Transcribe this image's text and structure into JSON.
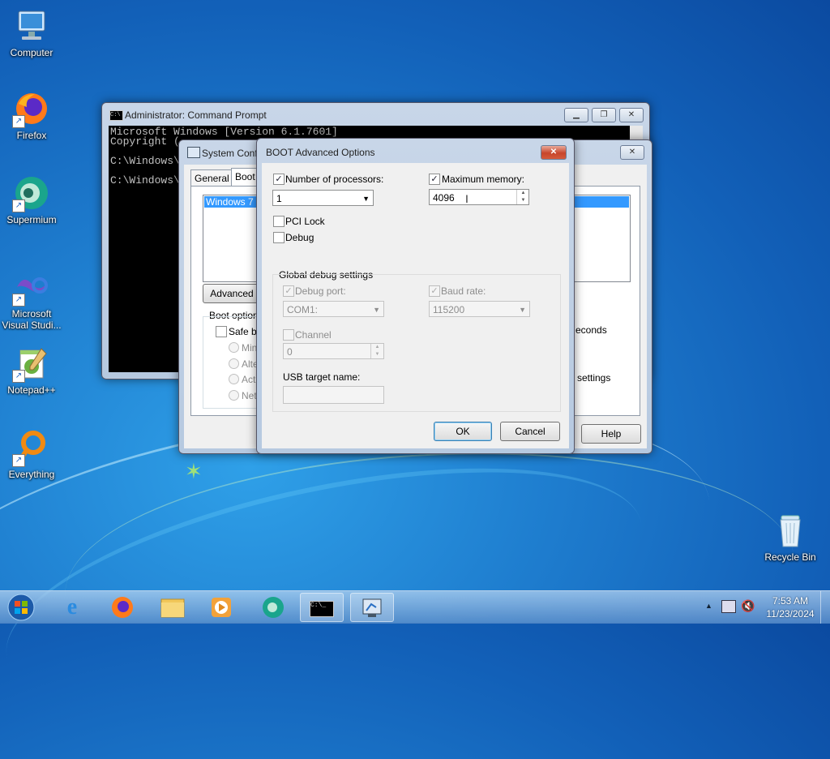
{
  "desktop": {
    "icons": [
      {
        "label": "Computer",
        "icon": "computer-icon"
      },
      {
        "label": "Firefox",
        "icon": "firefox-icon"
      },
      {
        "label": "Supermium",
        "icon": "supermium-icon"
      },
      {
        "label": "Microsoft Visual Studi...",
        "icon": "visual-studio-icon"
      },
      {
        "label": "Notepad++",
        "icon": "notepadpp-icon"
      },
      {
        "label": "Everything",
        "icon": "everything-icon"
      },
      {
        "label": "Recycle Bin",
        "icon": "recycle-bin-icon"
      }
    ]
  },
  "cmd": {
    "title": "Administrator: Command Prompt",
    "lines": [
      "Microsoft Windows [Version 6.1.7601]",
      "Copyright (",
      "",
      "C:\\Windows\\",
      "",
      "C:\\Windows\\"
    ]
  },
  "sysconfig": {
    "title": "System Conf",
    "tabs": [
      "General",
      "Boot"
    ],
    "os_entry": "Windows 7 (C",
    "advanced_button": "Advanced o",
    "boot_options_label": "Boot options",
    "safe_boot": "Safe bo",
    "radios": [
      "Minim",
      "Alter",
      "Activ",
      "Netw"
    ],
    "seconds_text": "econds",
    "settings_text": "settings",
    "help_button": "Help"
  },
  "boot_adv": {
    "title": "BOOT Advanced Options",
    "num_processors": {
      "label": "Number of processors:",
      "checked": true,
      "value": "1"
    },
    "max_memory": {
      "label": "Maximum memory:",
      "checked": true,
      "value": "4096"
    },
    "pci_lock": {
      "label": "PCI Lock",
      "checked": false
    },
    "debug": {
      "label": "Debug",
      "checked": false
    },
    "global_debug": {
      "label": "Global debug settings",
      "debug_port": {
        "label": "Debug port:",
        "value": "COM1:"
      },
      "baud_rate": {
        "label": "Baud rate:",
        "value": "115200"
      },
      "channel": {
        "label": "Channel",
        "value": "0"
      },
      "usb_target": {
        "label": "USB target name:",
        "value": ""
      }
    },
    "ok_button": "OK",
    "cancel_button": "Cancel"
  },
  "taskbar": {
    "clock_time": "7:53 AM",
    "clock_date": "11/23/2024"
  }
}
